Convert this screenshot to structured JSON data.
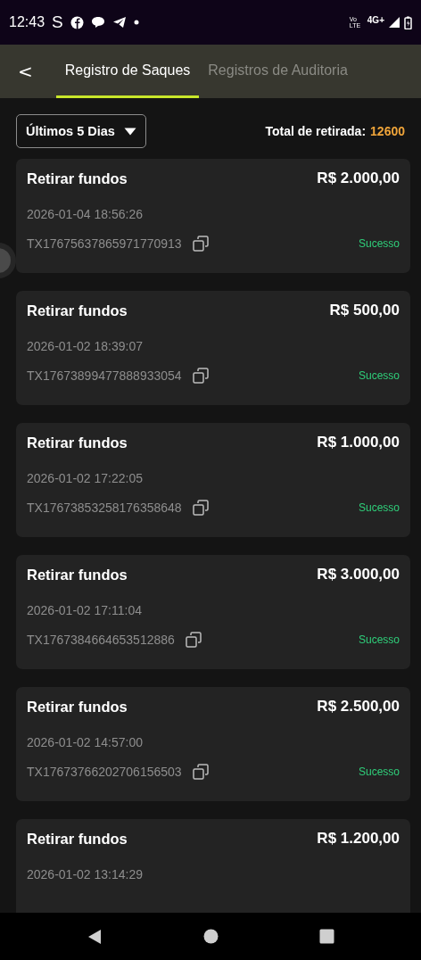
{
  "status_bar": {
    "time": "12:43",
    "app_glyph": "S",
    "network_volte": "Vo LTE",
    "network_type": "4G+"
  },
  "header": {
    "back_glyph": "<",
    "tabs": [
      {
        "label": "Registro de Saques",
        "selected": true
      },
      {
        "label": "Registros de Auditoria",
        "selected": false
      }
    ]
  },
  "filter": {
    "value": "Últimos 5 Dias"
  },
  "total": {
    "label": "Total de retirada:",
    "value": "12600"
  },
  "records": [
    {
      "title": "Retirar fundos",
      "amount": "R$ 2.000,00",
      "datetime": "2026-01-04 18:56:26",
      "tx_id": "TX17675637865971770913",
      "status": "Sucesso"
    },
    {
      "title": "Retirar fundos",
      "amount": "R$ 500,00",
      "datetime": "2026-01-02 18:39:07",
      "tx_id": "TX17673899477888933054",
      "status": "Sucesso"
    },
    {
      "title": "Retirar fundos",
      "amount": "R$ 1.000,00",
      "datetime": "2026-01-02 17:22:05",
      "tx_id": "TX17673853258176358648",
      "status": "Sucesso"
    },
    {
      "title": "Retirar fundos",
      "amount": "R$ 3.000,00",
      "datetime": "2026-01-02 17:11:04",
      "tx_id": "TX1767384664653512886",
      "status": "Sucesso"
    },
    {
      "title": "Retirar fundos",
      "amount": "R$ 2.500,00",
      "datetime": "2026-01-02 14:57:00",
      "tx_id": "TX17673766202706156503",
      "status": "Sucesso"
    },
    {
      "title": "Retirar fundos",
      "amount": "R$ 1.200,00",
      "datetime": "2026-01-02 13:14:29"
    }
  ]
}
